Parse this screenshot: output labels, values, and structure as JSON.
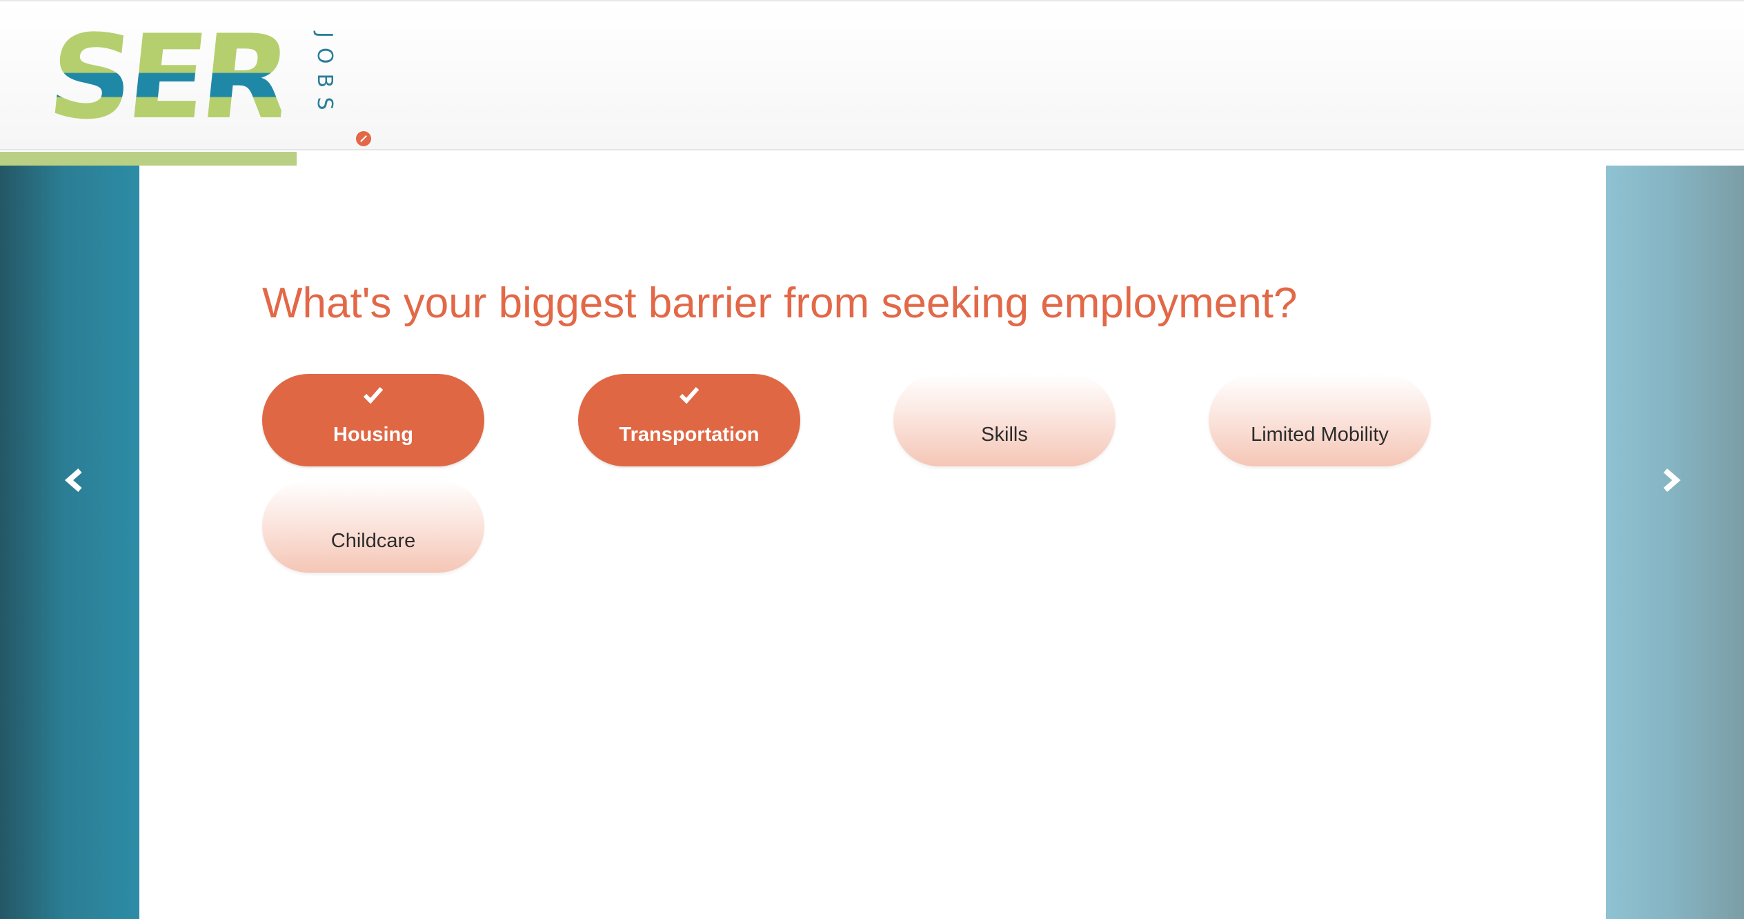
{
  "brand": {
    "logo_text": "SER",
    "logo_subtext": "JOBS"
  },
  "progress": {
    "fraction": 0.17
  },
  "question": {
    "text": "What's your biggest barrier from seeking employment?"
  },
  "options": [
    {
      "label": "Housing",
      "selected": true
    },
    {
      "label": "Transportation",
      "selected": true
    },
    {
      "label": "Skills",
      "selected": false
    },
    {
      "label": "Limited Mobility",
      "selected": false
    },
    {
      "label": "Childcare",
      "selected": false
    }
  ],
  "navigation": {
    "prev_icon": "chevron-left-icon",
    "next_icon": "chevron-right-icon"
  },
  "colors": {
    "accent": "#e26847",
    "progress": "#b8cf84",
    "panel_left": "#2d8ca6",
    "panel_right": "#8ec2d2"
  }
}
